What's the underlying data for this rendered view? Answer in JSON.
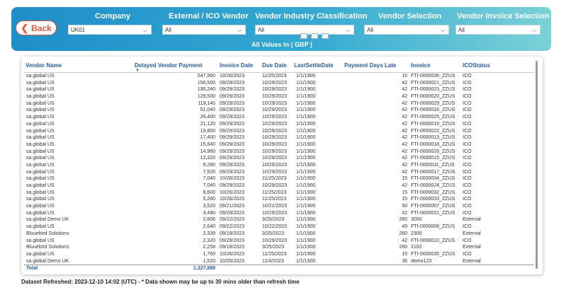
{
  "header": {
    "back_label": "Back",
    "subtitle": "All Values in ( GBP )",
    "filters": [
      {
        "label": "Company",
        "value": "UK01"
      },
      {
        "label": "External / ICO Vendor",
        "value": "All"
      },
      {
        "label": "Vendor Industry Classification",
        "value": "All"
      },
      {
        "label": "Vendor Selection",
        "value": "All"
      },
      {
        "label": "Vendor Invoice Selection",
        "value": "All"
      }
    ]
  },
  "table": {
    "columns": [
      "Vendor Name",
      "Delayed Vendor Payment",
      "Invoice Date",
      "Due Date",
      "LastSettleDate",
      "Payment Days Late",
      "Invoice",
      "ICOStatus"
    ],
    "rows": [
      [
        "sa.global US",
        "547,960",
        "10/26/2023",
        "11/25/2023",
        "1/1/1900",
        "15",
        "FTI-0000036_ZZUS",
        "ICO"
      ],
      [
        "sa.global US",
        "150,500",
        "09/29/2023",
        "10/29/2023",
        "1/1/1900",
        "42",
        "FTI-0000021_ZZUS",
        "ICO"
      ],
      [
        "sa.global US",
        "130,240",
        "09/29/2023",
        "10/29/2023",
        "1/1/1900",
        "42",
        "FTI-0000023_ZZUS",
        "ICO"
      ],
      [
        "sa.global US",
        "129,500",
        "09/29/2023",
        "10/29/2023",
        "1/1/1900",
        "42",
        "FTI-0000020_ZZUS",
        "ICO"
      ],
      [
        "sa.global US",
        "119,140",
        "09/29/2023",
        "10/29/2023",
        "1/1/1900",
        "42",
        "FTI-0000029_ZZUS",
        "ICO"
      ],
      [
        "sa.global US",
        "51,040",
        "09/29/2023",
        "10/29/2023",
        "1/1/1900",
        "42",
        "FTI-0000016_ZZUS",
        "ICO"
      ],
      [
        "sa.global US",
        "26,400",
        "09/29/2023",
        "10/29/2023",
        "1/1/1900",
        "42",
        "FTI-0000025_ZZUS",
        "ICO"
      ],
      [
        "sa.global US",
        "21,120",
        "09/29/2023",
        "10/29/2023",
        "1/1/1900",
        "42",
        "FTI-0000019_ZZUS",
        "ICO"
      ],
      [
        "sa.global US",
        "19,800",
        "09/29/2023",
        "10/29/2023",
        "1/1/1900",
        "42",
        "FTI-0000022_ZZUS",
        "ICO"
      ],
      [
        "sa.global US",
        "17,400",
        "09/29/2023",
        "10/29/2023",
        "1/1/1900",
        "42",
        "FTI-0000013_ZZUS",
        "ICO"
      ],
      [
        "sa.global US",
        "15,840",
        "09/29/2023",
        "10/29/2023",
        "1/1/1900",
        "42",
        "FTI-0000018_ZZUS",
        "ICO"
      ],
      [
        "sa.global US",
        "14,960",
        "09/29/2023",
        "10/29/2023",
        "1/1/1900",
        "42",
        "FTI-0000026_ZZUS",
        "ICO"
      ],
      [
        "sa.global US",
        "12,320",
        "09/29/2023",
        "10/29/2023",
        "1/1/1900",
        "42",
        "FTI-0000015_ZZUS",
        "ICO"
      ],
      [
        "sa.global US",
        "9,280",
        "09/29/2023",
        "10/29/2023",
        "1/1/1900",
        "42",
        "FTI-0000011_ZZUS",
        "ICO"
      ],
      [
        "sa.global US",
        "7,920",
        "09/29/2023",
        "10/29/2023",
        "1/1/1900",
        "42",
        "FTI-0000017_ZZUS",
        "ICO"
      ],
      [
        "sa.global US",
        "7,040",
        "10/26/2023",
        "11/25/2023",
        "1/1/1900",
        "15",
        "FTI-0000034_ZZUS",
        "ICO"
      ],
      [
        "sa.global US",
        "7,040",
        "09/29/2023",
        "10/29/2023",
        "1/1/1900",
        "42",
        "FTI-0000024_ZZUS",
        "ICO"
      ],
      [
        "sa.global US",
        "6,600",
        "10/26/2023",
        "11/25/2023",
        "1/1/1900",
        "15",
        "FTI-0000032_ZZUS",
        "ICO"
      ],
      [
        "sa.global US",
        "5,280",
        "10/26/2023",
        "11/25/2023",
        "1/1/1900",
        "15",
        "FTI-0000033_ZZUS",
        "ICO"
      ],
      [
        "sa.global US",
        "3,520",
        "09/21/2023",
        "10/21/2023",
        "1/1/1900",
        "50",
        "FTI-0000007_ZZUS",
        "ICO"
      ],
      [
        "sa.global US",
        "3,480",
        "09/29/2023",
        "10/29/2023",
        "1/1/1900",
        "42",
        "FTI-0000031_ZZUS",
        "ICO"
      ],
      [
        "sa.global Demo UK",
        "2,806",
        "09/22/2023",
        "3/25/2023",
        "1/1/1900",
        "260",
        "3000",
        "External"
      ],
      [
        "sa.global US",
        "2,640",
        "09/22/2023",
        "10/22/2023",
        "1/1/1900",
        "49",
        "FTI-0000008_ZZUS",
        "ICO"
      ],
      [
        "Bluuebird Solutions",
        "2,339",
        "09/19/2023",
        "3/25/2023",
        "1/1/1900",
        "260",
        "2300",
        "External"
      ],
      [
        "sa.global US",
        "2,320",
        "09/29/2023",
        "10/29/2023",
        "1/1/1900",
        "42",
        "FTI-0000010_ZZUS",
        "ICO"
      ],
      [
        "Bluuebird Solutions",
        "2,258",
        "09/18/2023",
        "3/25/2023",
        "1/1/1900",
        "260",
        "2102",
        "External"
      ],
      [
        "sa.global US",
        "1,760",
        "10/26/2023",
        "11/25/2023",
        "1/1/1900",
        "15",
        "FTI-0000035_ZZUS",
        "ICO"
      ],
      [
        "sa.global Demo UK",
        "1,520",
        "10/05/2023",
        "11/4/2023",
        "1/1/1900",
        "36",
        "demo123",
        "External"
      ]
    ],
    "total_label": "Total",
    "total_value": "1,327,888"
  },
  "footer": {
    "refresh_text": "Dataset Refreshed: 2023-12-10 14:02 (UTC) - * Data shown may be up to 30 mins older than refresh time"
  },
  "colors": {
    "header_gradient_start": "#1d8ec9",
    "header_gradient_end": "#7ad1d7",
    "back_button_accent": "#e25b3a",
    "column_header_text": "#2a5d9c"
  }
}
